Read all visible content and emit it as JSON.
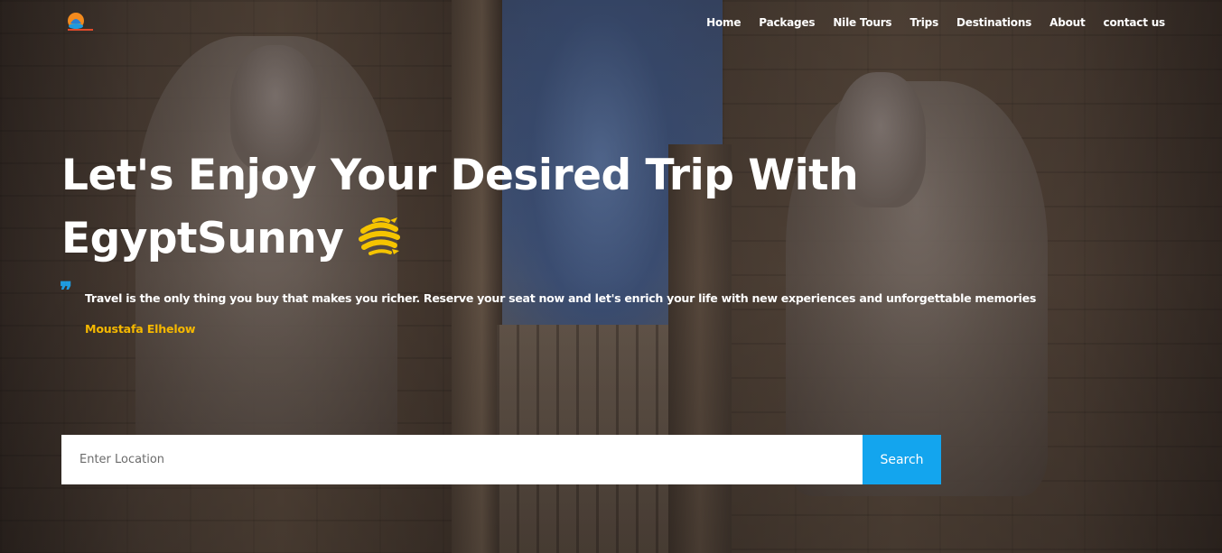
{
  "brand": {
    "logo_icon": "egyptsunny-logo-icon"
  },
  "nav": {
    "items": [
      {
        "label": "Home"
      },
      {
        "label": "Packages"
      },
      {
        "label": "Nile Tours"
      },
      {
        "label": "Trips"
      },
      {
        "label": "Destinations"
      },
      {
        "label": "About"
      },
      {
        "label": "contact us"
      }
    ]
  },
  "hero": {
    "headline_line1": "Let's Enjoy Your Desired Trip With",
    "headline_line2": "EgyptSunny",
    "headline_icon": "globe-plane-icon",
    "quote_icon": "quote-icon",
    "quote_mark": "❞",
    "quote_text": "Travel is the only thing you buy that makes you richer. Reserve your seat now and let's enrich your life with new experiences and unforgettable memories",
    "quote_author": "Moustafa Elhelow"
  },
  "search": {
    "placeholder": "Enter Location",
    "value": "",
    "button_label": "Search"
  },
  "colors": {
    "accent_blue": "#13a5ee",
    "author_gold": "#f5b800",
    "text_white": "#ffffff"
  }
}
